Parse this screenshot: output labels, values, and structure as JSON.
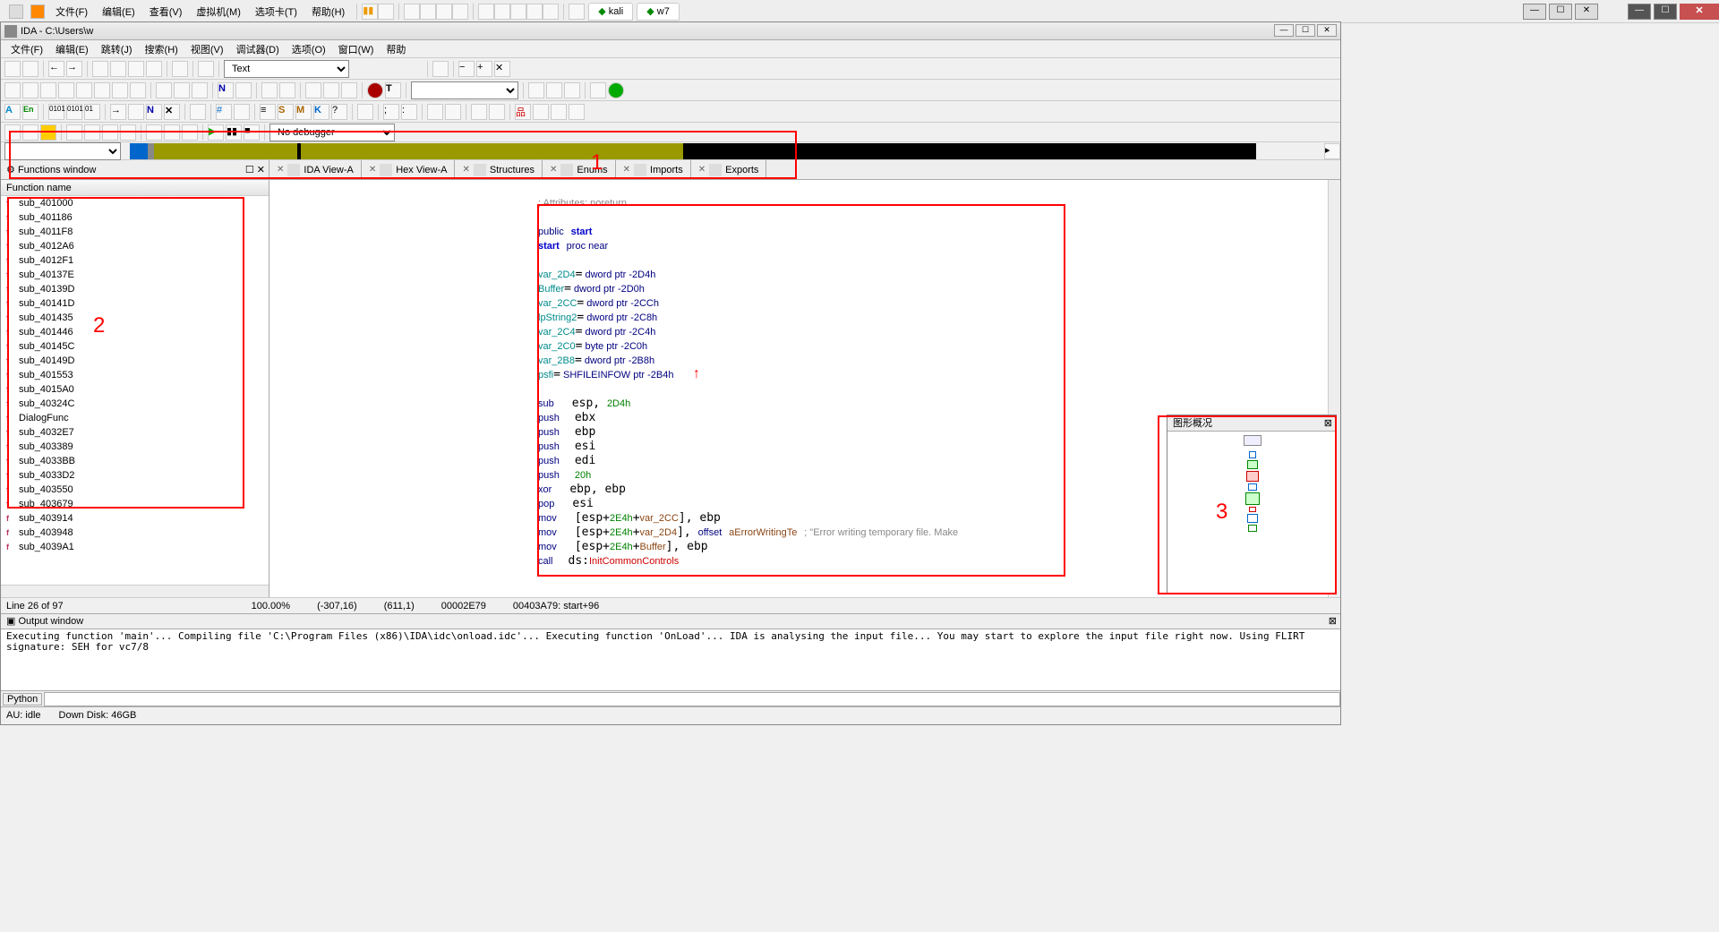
{
  "vm": {
    "menu": [
      "文件(F)",
      "编辑(E)",
      "查看(V)",
      "虚拟机(M)",
      "选项卡(T)",
      "帮助(H)"
    ],
    "tabs": [
      {
        "label": "kali",
        "active": false
      },
      {
        "label": "w7",
        "active": true
      }
    ]
  },
  "ida": {
    "title": "IDA - C:\\Users\\w",
    "menu": [
      "文件(F)",
      "编辑(E)",
      "跳转(J)",
      "搜索(H)",
      "视图(V)",
      "调试器(D)",
      "选项(O)",
      "窗口(W)",
      "帮助"
    ],
    "toolbar": {
      "text_combo": "Text",
      "debugger_combo": "No debugger"
    },
    "tabs": {
      "functions_window": "Functions window",
      "list": [
        {
          "label": "IDA View-A",
          "icon": "ida-view"
        },
        {
          "label": "Hex View-A",
          "icon": "hex-view"
        },
        {
          "label": "Structures",
          "icon": "structures"
        },
        {
          "label": "Enums",
          "icon": "enums"
        },
        {
          "label": "Imports",
          "icon": "imports"
        },
        {
          "label": "Exports",
          "icon": "exports"
        }
      ]
    },
    "functions": {
      "header": "Function name",
      "items": [
        "sub_401000",
        "sub_401186",
        "sub_4011F8",
        "sub_4012A6",
        "sub_4012F1",
        "sub_40137E",
        "sub_40139D",
        "sub_40141D",
        "sub_401435",
        "sub_401446",
        "sub_40145C",
        "sub_40149D",
        "sub_401553",
        "sub_4015A0",
        "sub_40324C",
        "DialogFunc",
        "sub_4032E7",
        "sub_403389",
        "sub_4033BB",
        "sub_4033D2",
        "sub_403550",
        "sub_403679",
        "sub_403914",
        "sub_403948",
        "sub_4039A1"
      ]
    },
    "code": {
      "attributes": "; Attributes: noreturn",
      "public": "public start",
      "proc": "start proc near",
      "vars": [
        "var_2D4= dword ptr -2D4h",
        "Buffer= dword ptr -2D0h",
        "var_2CC= dword ptr -2CCh",
        "lpString2= dword ptr -2C8h",
        "var_2C4= dword ptr -2C4h",
        "var_2C0= byte ptr -2C0h",
        "var_2B8= dword ptr -2B8h",
        "psfi= SHFILEINFOW ptr -2B4h"
      ],
      "asm": [
        {
          "op": "sub",
          "args": "esp, 2D4h"
        },
        {
          "op": "push",
          "args": "ebx"
        },
        {
          "op": "push",
          "args": "ebp"
        },
        {
          "op": "push",
          "args": "esi"
        },
        {
          "op": "push",
          "args": "edi"
        },
        {
          "op": "push",
          "args": "20h"
        },
        {
          "op": "xor",
          "args": "ebp, ebp"
        },
        {
          "op": "pop",
          "args": "esi"
        },
        {
          "op": "mov",
          "args": "[esp+2E4h+var_2CC], ebp"
        },
        {
          "op": "mov",
          "args": "[esp+2E4h+var_2D4], offset aErrorWritingTe",
          "comment": "; \"Error writing temporary file. Make"
        },
        {
          "op": "mov",
          "args": "[esp+2E4h+Buffer], ebp"
        },
        {
          "op": "call",
          "args": "ds:InitCommonControls"
        }
      ]
    },
    "graph_overview": {
      "title": "图形概况"
    },
    "status": {
      "line": "Line 26 of 97",
      "zoom": "100.00%",
      "coord1": "(-307,16)",
      "coord2": "(611,1)",
      "offset": "00002E79",
      "addr": "00403A79: start+96"
    },
    "output": {
      "title": "Output window",
      "lines": [
        "Executing function 'main'...",
        "Compiling file 'C:\\Program Files (x86)\\IDA\\idc\\onload.idc'...",
        "Executing function 'OnLoad'...",
        "IDA is analysing the input file...",
        "You may start to explore the input file right now.",
        "Using FLIRT signature: SEH for vc7/8"
      ]
    },
    "python_label": "Python",
    "bottom": {
      "au": "AU:  idle",
      "disk": "Down Disk: 46GB"
    }
  },
  "annotations": {
    "a1": "1",
    "a2": "2",
    "a3": "3"
  }
}
